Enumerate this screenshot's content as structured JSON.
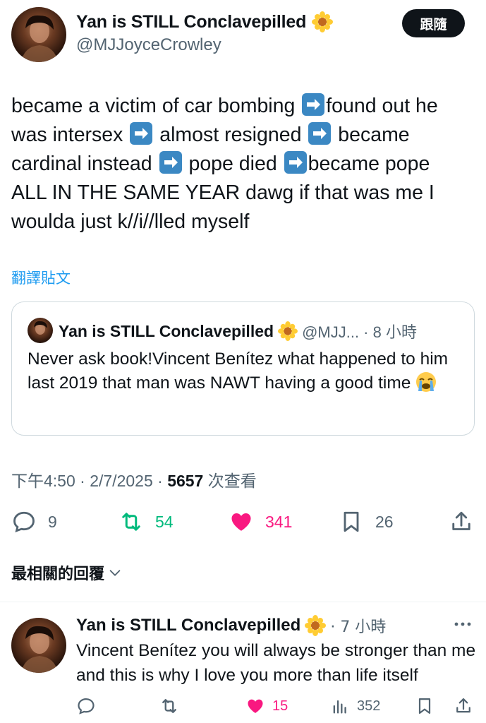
{
  "author": {
    "display_name": "Yan is STILL Conclavepilled",
    "handle": "@MJJoyceCrowley",
    "name_emoji": "sunflower-emoji"
  },
  "follow_button": {
    "label": "跟隨"
  },
  "tweet": {
    "lines": [
      {
        "before": "became a victim of car bombing ",
        "after": "found out he"
      },
      {
        "before": "was intersex ",
        "middle": " almost resigned ",
        "after": " became"
      },
      {
        "before": "cardinal instead ",
        "middle": " pope died ",
        "after": "became pope"
      },
      {
        "text": "ALL IN THE SAME YEAR dawg if that was me I"
      },
      {
        "text": "woulda just k//i//lled myself"
      }
    ],
    "arrow_emoji": "right-arrow-emoji"
  },
  "translate_link": "翻譯貼文",
  "quote": {
    "display_name": "Yan is STILL Conclavepilled",
    "meta": "@MJJ... · 8 小時",
    "text": "Never ask book!Vincent Benítez what happened to him last 2019 that man was NAWT having a good time",
    "emoji": "loudly-crying-face-emoji"
  },
  "timestamp": {
    "time_date": "下午4:50 · 2/7/2025 · ",
    "views_count": "5657",
    "views_label": " 次查看"
  },
  "actions": {
    "replies": "9",
    "reposts": "54",
    "likes": "341",
    "bookmarks": "26"
  },
  "relevant_replies_label": "最相關的回覆",
  "reply": {
    "display_name": "Yan is STILL Conclavepilled",
    "time": "· 7 小時",
    "text": "Vincent Benítez you will always be stronger than me and this is why I love you more than life itself",
    "likes": "15",
    "views": "352"
  },
  "colors": {
    "accent": "#1d9bf0",
    "repost": "#00ba7c",
    "like": "#f91880",
    "secondary_text": "#536471",
    "primary_text": "#0f1419"
  }
}
